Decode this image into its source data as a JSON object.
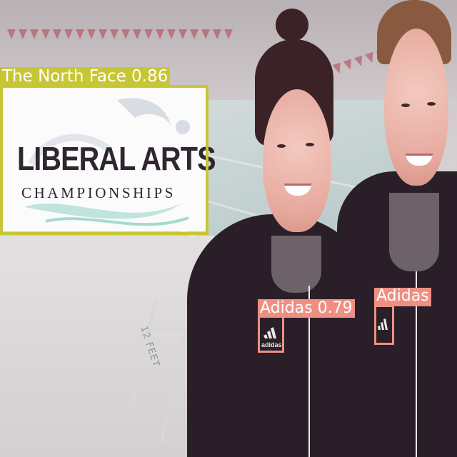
{
  "banner": {
    "line1": "LIBERAL ARTS",
    "line2": "CHAMPIONSHIPS"
  },
  "scene": {
    "depth_marking": "12 FEET"
  },
  "detections": [
    {
      "label": "The North Face 0.86",
      "color": "#c7c635"
    },
    {
      "label": "Adidas 0.79",
      "color": "#ef8f83"
    },
    {
      "label": "Adidas",
      "color": "#ef8f83"
    }
  ],
  "jacket_logo_text": "adidas"
}
